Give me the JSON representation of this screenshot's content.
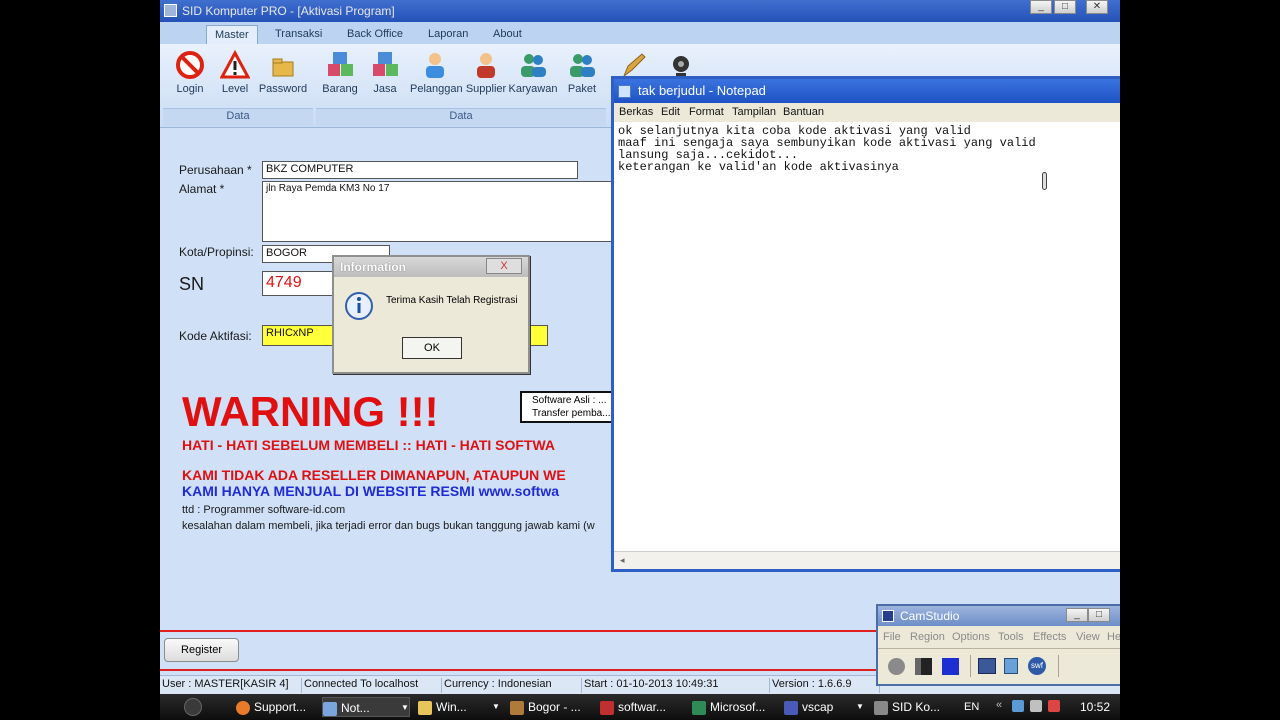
{
  "main_window": {
    "title": "SID Komputer PRO - [Aktivasi Program]",
    "tabs": [
      "Master",
      "Transaksi",
      "Back Office",
      "Laporan",
      "About"
    ],
    "active_tab": "Master",
    "ribbon_buttons": [
      {
        "label": "Login",
        "icon": "no-entry-icon"
      },
      {
        "label": "Level",
        "icon": "warning-icon"
      },
      {
        "label": "Password",
        "icon": "folder-icon"
      },
      {
        "label": "Barang",
        "icon": "boxes-icon"
      },
      {
        "label": "Jasa",
        "icon": "boxes-icon"
      },
      {
        "label": "Pelanggan",
        "icon": "customer-icon"
      },
      {
        "label": "Supplier",
        "icon": "supplier-icon"
      },
      {
        "label": "Karyawan",
        "icon": "employee-icon"
      },
      {
        "label": "Paket",
        "icon": "package-icon"
      }
    ],
    "group_labels": [
      "Data",
      "Data"
    ],
    "form": {
      "perusahaan_label": "Perusahaan *",
      "perusahaan_value": "BKZ COMPUTER",
      "alamat_label": "Alamat *",
      "alamat_value": "jln Raya Pemda KM3 No 17",
      "kota_label": "Kota/Propinsi:",
      "kota_value": "BOGOR",
      "sn_label": "SN",
      "sn_value": "4749",
      "kode_label": "Kode Aktifasi:",
      "kode_value": "RHICxNP"
    },
    "info_box_lines": [
      "Software Asli : ...",
      "Transfer pemba..."
    ],
    "warning_title": "WARNING !!!",
    "warning_line1": "HATI - HATI SEBELUM MEMBELI :: HATI - HATI SOFTWA",
    "warning_line2": "KAMI TIDAK ADA RESELLER DIMANAPUN, ATAUPUN WE",
    "warning_line3": "KAMI HANYA MENJUAL DI WEBSITE RESMI www.softwa",
    "ttd": "ttd : Programmer software-id.com",
    "disclaimer": "kesalahan dalam membeli, jika terjadi error dan bugs bukan tanggung jawab kami (w",
    "register_label": "Register",
    "status": {
      "user": "User : MASTER[KASIR 4]",
      "conn": "Connected To localhost",
      "currency": "Currency : Indonesian",
      "start": "Start  : 01-10-2013 10:49:31",
      "version": "Version : 1.6.6.9"
    }
  },
  "dialog": {
    "title": "Information",
    "message": "Terima Kasih Telah Registrasi",
    "ok": "OK",
    "close": "X"
  },
  "notepad": {
    "title": "tak berjudul - Notepad",
    "menu": [
      "Berkas",
      "Edit",
      "Format",
      "Tampilan",
      "Bantuan"
    ],
    "text": "ok selanjutnya kita coba kode aktivasi yang valid\nmaaf ini sengaja saya sembunyikan kode aktivasi yang valid\nlansung saja...cekidot...\nketerangan ke valid'an kode aktivasinya"
  },
  "camstudio": {
    "title": "CamStudio",
    "menu": [
      "File",
      "Region",
      "Options",
      "Tools",
      "Effects",
      "View",
      "He"
    ]
  },
  "taskbar": {
    "items": [
      "Support...",
      "Not...",
      "Win...",
      "Bogor - ...",
      "softwar...",
      "Microsof...",
      "vscap",
      "SID Ko..."
    ],
    "lang": "EN",
    "clock": "10:52"
  }
}
